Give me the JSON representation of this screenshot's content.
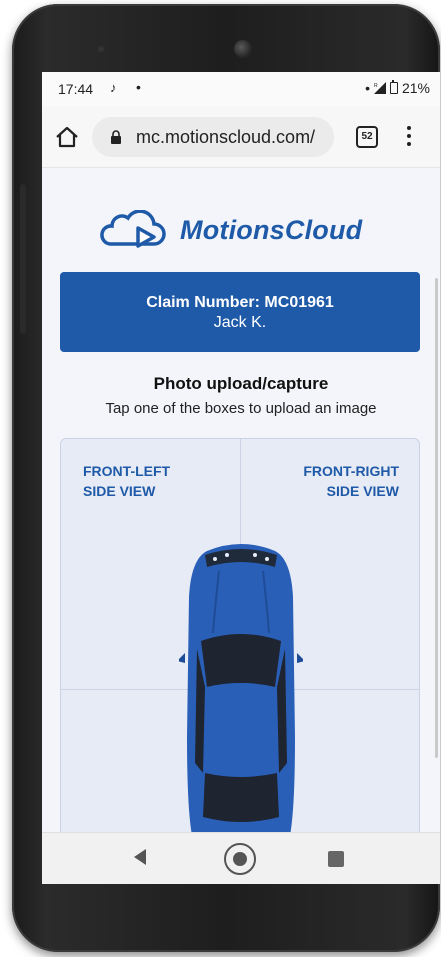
{
  "status_bar": {
    "time": "17:44",
    "tiktok_icon": "♪",
    "dot": "•",
    "battery": "21%"
  },
  "browser": {
    "url": "mc.motionscloud.com/",
    "tab_count": "52"
  },
  "page": {
    "logo_text": "MotionsCloud",
    "claim_number": "Claim Number: MC01961",
    "claimant_name": "Jack K.",
    "section_title": "Photo upload/capture",
    "section_subtitle": "Tap one of the boxes to upload an image",
    "cells": {
      "front_left": "FRONT-LEFT\nSIDE VIEW",
      "front_right": "FRONT-RIGHT\nSIDE VIEW"
    }
  },
  "colors": {
    "brand_blue": "#1f5aa8",
    "car_blue": "#2a5fb8",
    "page_bg": "#f3f5fb"
  }
}
